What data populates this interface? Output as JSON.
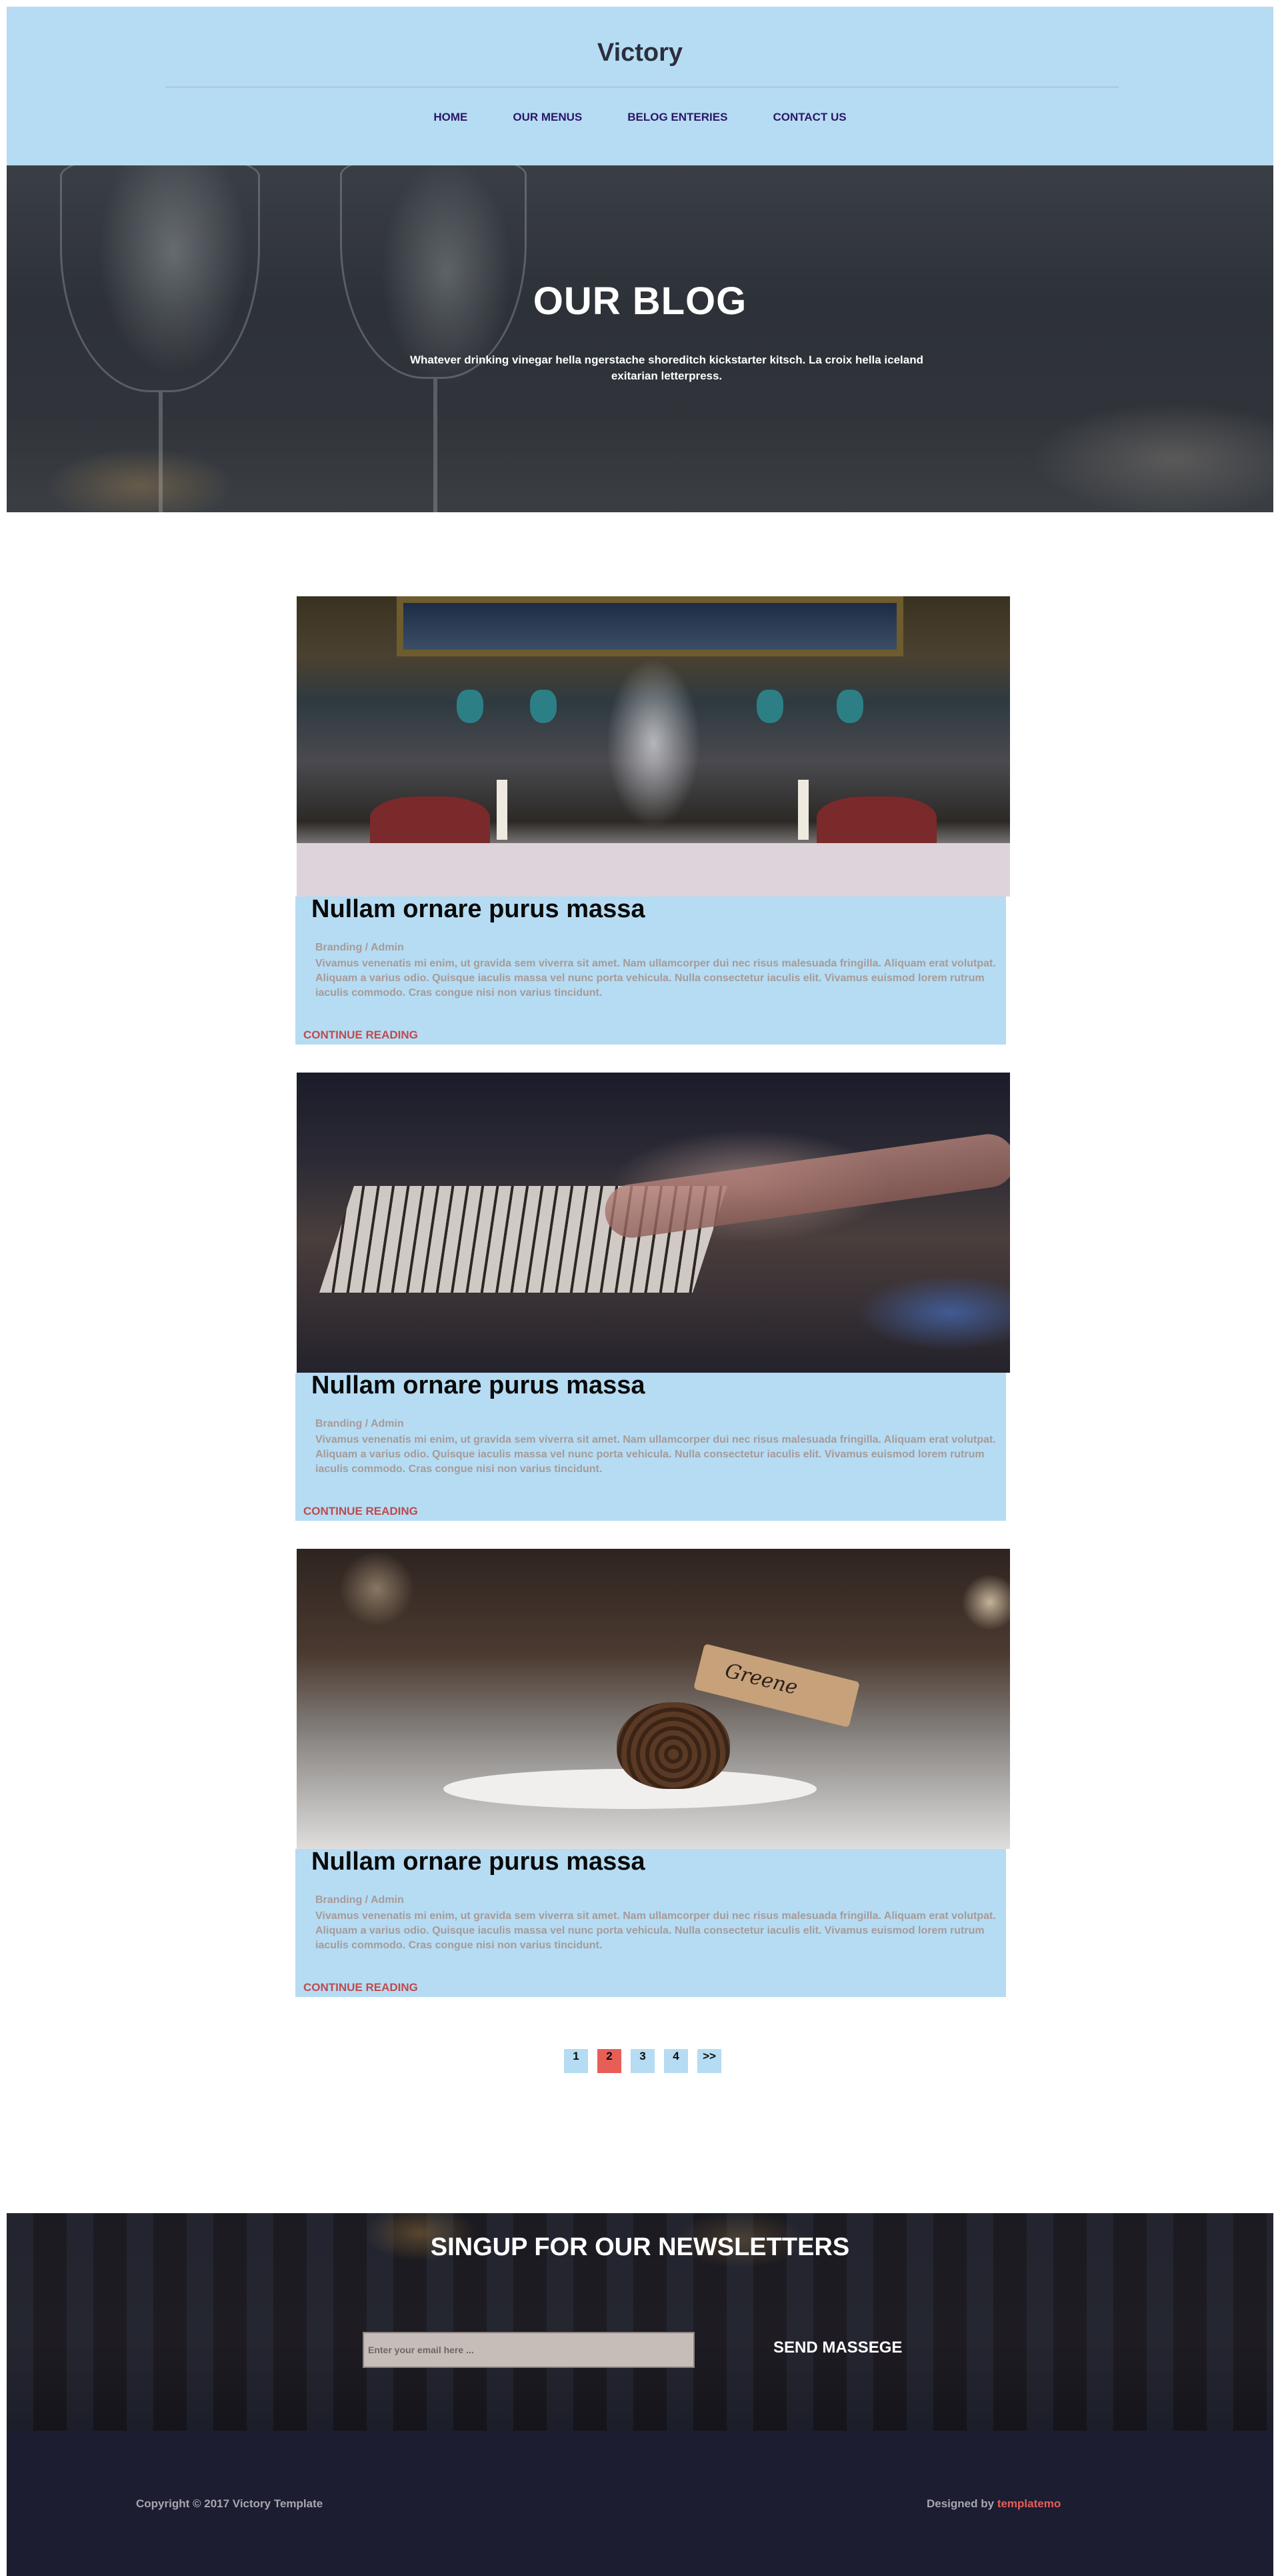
{
  "header": {
    "brand": "Victory",
    "nav": [
      {
        "label": "HOME"
      },
      {
        "label": "OUR MENUS"
      },
      {
        "label": "BELOG ENTERIES"
      },
      {
        "label": "CONTACT US"
      }
    ]
  },
  "hero": {
    "title": "OUR BLOG",
    "subtitle": "Whatever drinking vinegar hella ngerstache shoreditch kickstarter kitsch. La croix hella iceland exitarian letterpress."
  },
  "posts": [
    {
      "title": "Nullam ornare purus massa",
      "meta": "Branding / Admin",
      "excerpt": "Vivamus venenatis mi enim, ut gravida sem viverra sit amet. Nam ullamcorper dui nec risus malesuada fringilla. Aliquam erat volutpat. Aliquam a varius odio. Quisque iaculis massa vel nunc porta vehicula. Nulla consectetur iaculis elit. Vivamus euismod lorem rutrum iaculis commodo. Cras congue nisi non varius tincidunt.",
      "more_label": "CONTINUE READING"
    },
    {
      "title": "Nullam ornare purus massa",
      "meta": "Branding / Admin",
      "excerpt": "Vivamus venenatis mi enim, ut gravida sem viverra sit amet. Nam ullamcorper dui nec risus malesuada fringilla. Aliquam erat volutpat. Aliquam a varius odio. Quisque iaculis massa vel nunc porta vehicula. Nulla consectetur iaculis elit. Vivamus euismod lorem rutrum iaculis commodo. Cras congue nisi non varius tincidunt.",
      "more_label": "CONTINUE READING"
    },
    {
      "title": "Nullam ornare purus massa",
      "meta": "Branding / Admin",
      "excerpt": "Vivamus venenatis mi enim, ut gravida sem viverra sit amet. Nam ullamcorper dui nec risus malesuada fringilla. Aliquam erat volutpat. Aliquam a varius odio. Quisque iaculis massa vel nunc porta vehicula. Nulla consectetur iaculis elit. Vivamus euismod lorem rutrum iaculis commodo. Cras congue nisi non varius tincidunt.",
      "more_label": "CONTINUE READING",
      "tag_text": "Greene"
    }
  ],
  "pagination": {
    "pages": [
      "1",
      "2",
      "3",
      "4",
      ">>"
    ],
    "active": "2"
  },
  "newsletter": {
    "title": "SINGUP FOR OUR NEWSLETTERS",
    "placeholder": "Enter your email here ...",
    "send_label": "SEND MASSEGE"
  },
  "footer": {
    "copyright": "Copyright © 2017 Victory Template",
    "designed_prefix": "Designed by ",
    "designed_link": "templatemo"
  },
  "colors": {
    "header_bg": "#b5dcf3",
    "accent": "#e75e57",
    "nav_text": "#2c1667",
    "footer_bg": "#1c1d31",
    "more_link": "#bf4a4d"
  }
}
